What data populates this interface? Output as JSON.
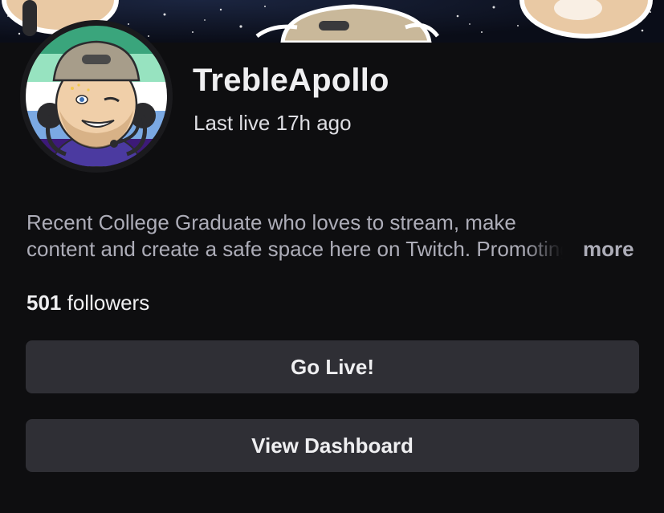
{
  "channel": {
    "name": "TrebleApollo",
    "last_live": "Last live 17h ago",
    "bio_line1": "Recent College Graduate who loves to stream, make",
    "bio_line2": "content and create a safe space here on Twitch. Promoting",
    "more_label": "more",
    "followers_count": "501",
    "followers_label": "followers"
  },
  "actions": {
    "go_live_label": "Go Live!",
    "dashboard_label": "View Dashboard"
  },
  "colors": {
    "background": "#0e0e10",
    "button": "#2f2f35",
    "muted_text": "#adadb8",
    "flag_stripes": [
      "#3aa57c",
      "#97e3c0",
      "#ffffff",
      "#7ba9e3",
      "#3d1a78"
    ]
  }
}
